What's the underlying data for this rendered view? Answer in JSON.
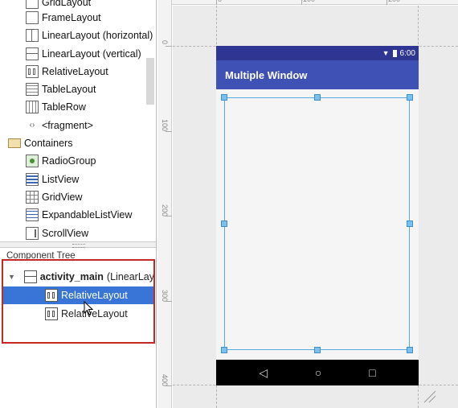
{
  "palette": {
    "items": [
      {
        "label": "GridLayout",
        "icon": "grid-layout-icon"
      },
      {
        "label": "FrameLayout",
        "icon": "frame-layout-icon"
      },
      {
        "label": "LinearLayout (horizontal)",
        "icon": "linear-horizontal-icon"
      },
      {
        "label": "LinearLayout (vertical)",
        "icon": "linear-vertical-icon"
      },
      {
        "label": "RelativeLayout",
        "icon": "relative-layout-icon"
      },
      {
        "label": "TableLayout",
        "icon": "table-layout-icon"
      },
      {
        "label": "TableRow",
        "icon": "table-row-icon"
      },
      {
        "label": "<fragment>",
        "icon": "fragment-icon"
      },
      {
        "label": "Containers",
        "icon": "folder-icon"
      },
      {
        "label": "RadioGroup",
        "icon": "radio-group-icon"
      },
      {
        "label": "ListView",
        "icon": "list-view-icon"
      },
      {
        "label": "GridView",
        "icon": "grid-view-icon"
      },
      {
        "label": "ExpandableListView",
        "icon": "expandable-list-icon"
      },
      {
        "label": "ScrollView",
        "icon": "scroll-view-icon"
      }
    ]
  },
  "tree": {
    "title": "Component Tree",
    "root": {
      "label_bold": "activity_main",
      "label_rest": "(LinearLay"
    },
    "children": [
      {
        "label": "RelativeLayout",
        "selected": true
      },
      {
        "label": "RelativeLayout",
        "selected": false
      }
    ]
  },
  "rulers": {
    "horizontal": [
      "0",
      "100",
      "200"
    ],
    "vertical": [
      "0",
      "100",
      "200",
      "300",
      "400"
    ]
  },
  "device": {
    "time": "6:00",
    "app_title": "Multiple Window",
    "colors": {
      "status_bar": "#2e3592",
      "app_bar": "#3f51b5",
      "nav_bar": "#000000"
    }
  },
  "highlight_color": "#c62828",
  "selection_color": "#3875d7"
}
